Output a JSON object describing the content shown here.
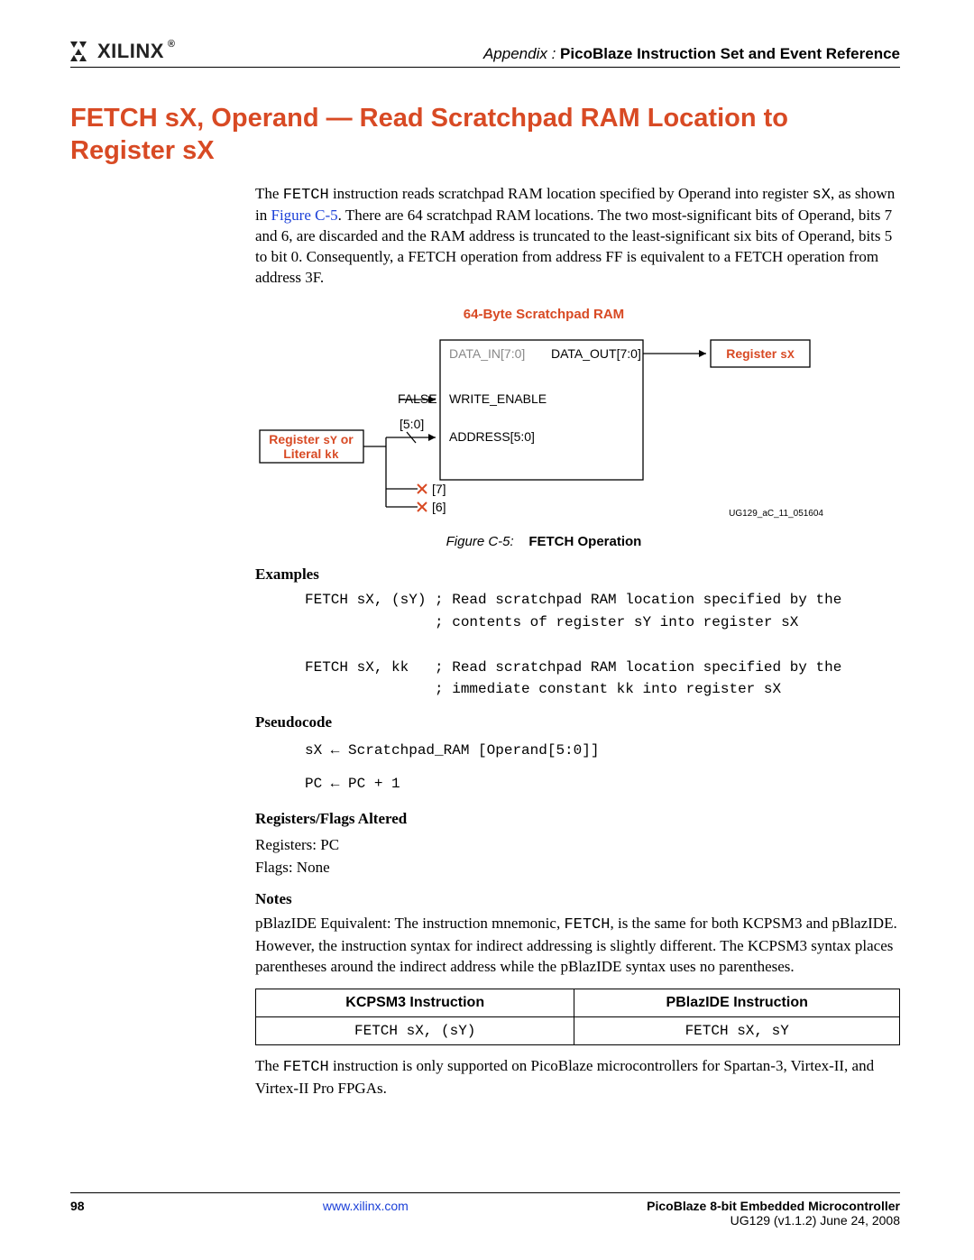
{
  "header": {
    "logo_text": "XILINX",
    "appendix_prefix": "Appendix :",
    "appendix_title": "PicoBlaze Instruction Set and Event Reference"
  },
  "title": "FETCH sX, Operand — Read Scratchpad RAM Location to Register sX",
  "intro": {
    "p1a": "The ",
    "p1_code": "FETCH",
    "p1b": " instruction reads scratchpad RAM location specified by Operand into register ",
    "p1_code2": "sX",
    "p1c": ", as shown in ",
    "p1_link": "Figure C-5",
    "p1d": ". There are 64 scratchpad RAM locations. The two most-significant bits of Operand, bits 7 and 6, are discarded and the RAM address is truncated to the least-significant six bits of Operand, bits 5 to bit 0. Consequently, a FETCH operation from address FF is equivalent to a FETCH operation from address 3F."
  },
  "figure": {
    "title": "64-Byte Scratchpad RAM",
    "data_in": "DATA_IN[7:0]",
    "data_out": "DATA_OUT[7:0]",
    "register_sx": "Register ",
    "register_sx_code": "sX",
    "false_label": "FALSE",
    "write_enable": "WRITE_ENABLE",
    "bits_50": "[5:0]",
    "reg_sy_or": "Register ",
    "sy_code": "sY",
    "or_word": " or",
    "literal": "Literal ",
    "kk_code": "kk",
    "address": "ADDRESS[5:0]",
    "bit7": "[7]",
    "bit6": "[6]",
    "id": "UG129_aC_11_051604",
    "caption_prefix": "Figure C-5:",
    "caption_bold": "FETCH Operation"
  },
  "examples": {
    "heading": "Examples",
    "code": "FETCH sX, (sY) ; Read scratchpad RAM location specified by the\n               ; contents of register sY into register sX\n\nFETCH sX, kk   ; Read scratchpad RAM location specified by the\n               ; immediate constant kk into register sX"
  },
  "pseudocode": {
    "heading": "Pseudocode",
    "line1": "sX ← Scratchpad_RAM [Operand[5:0]]",
    "line2": "PC ← PC + 1"
  },
  "regs": {
    "heading": "Registers/Flags Altered",
    "l1": "Registers: PC",
    "l2": "Flags: None"
  },
  "notes": {
    "heading": "Notes",
    "p1a": "pBlazIDE Equivalent: The instruction mnemonic, ",
    "p1_code": "FETCH",
    "p1b": ", is the same for both KCPSM3 and pBlazIDE. However, the instruction syntax for indirect addressing is slightly different. The KCPSM3 syntax places parentheses around the indirect address while the pBlazIDE syntax uses no parentheses."
  },
  "table": {
    "h1": "KCPSM3 Instruction",
    "h2": "PBlazIDE Instruction",
    "c1": "FETCH sX, (sY)",
    "c2": "FETCH sX, sY"
  },
  "tail": {
    "p1a": "The ",
    "p1_code": "FETCH",
    "p1b": " instruction is only supported on PicoBlaze microcontrollers for Spartan-3, Virtex-II, and Virtex-II Pro FPGAs."
  },
  "footer": {
    "page": "98",
    "url": "www.xilinx.com",
    "title": "PicoBlaze 8-bit Embedded Microcontroller",
    "ver": "UG129 (v1.1.2) June 24, 2008"
  }
}
